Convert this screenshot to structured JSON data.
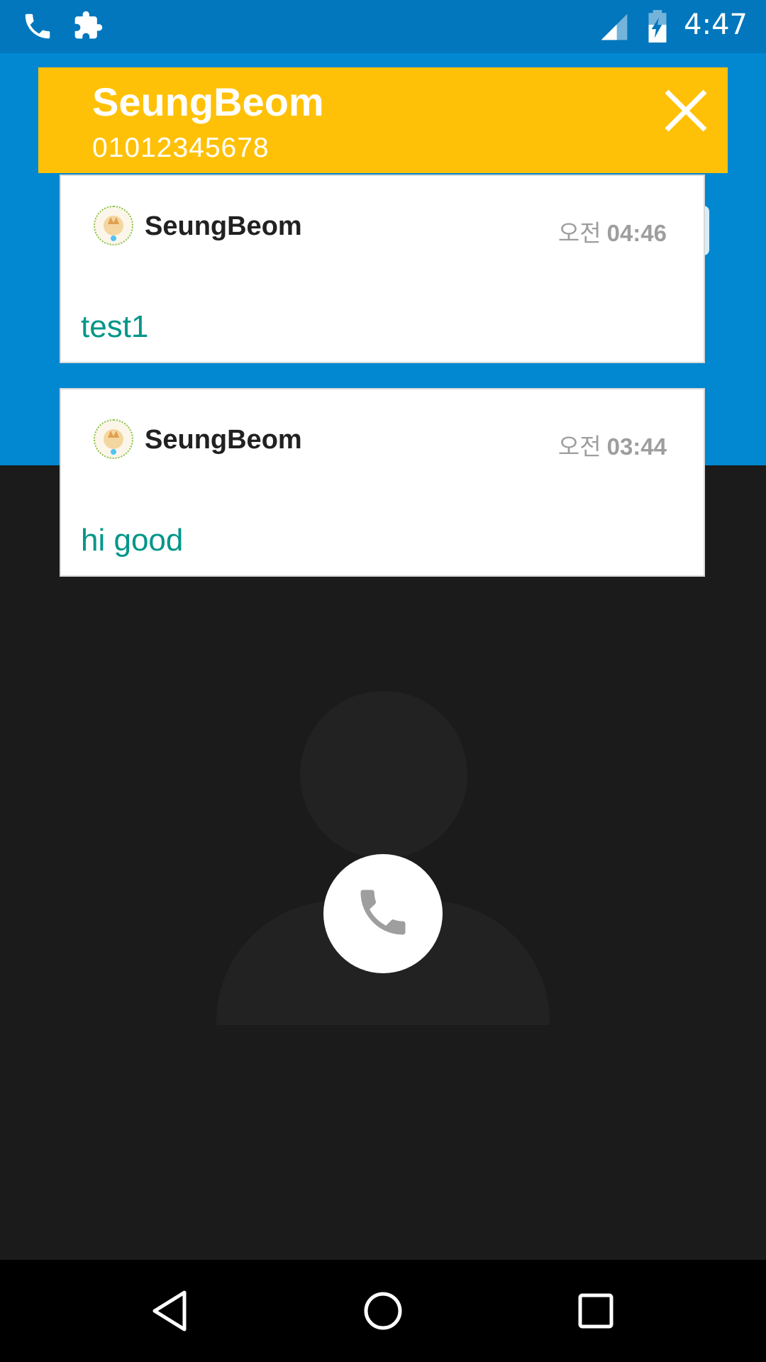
{
  "status_bar": {
    "time": "4:47",
    "icons": [
      "phone-icon",
      "puzzle-icon",
      "signal-icon",
      "battery-charging-icon"
    ]
  },
  "caller_banner": {
    "name": "SeungBeom",
    "number": "01012345678",
    "close_icon": "close-icon",
    "background_color": "#ffc107"
  },
  "messages": [
    {
      "sender": "SeungBeom",
      "ampm": "오전",
      "time": "04:46",
      "body": "test1"
    },
    {
      "sender": "SeungBeom",
      "ampm": "오전",
      "time": "03:44",
      "body": "hi good"
    }
  ],
  "call_screen": {
    "answer_icon": "phone-icon",
    "header_color": "#0288d1"
  },
  "nav_bar": {
    "buttons": [
      "back-icon",
      "home-icon",
      "recents-icon"
    ]
  }
}
